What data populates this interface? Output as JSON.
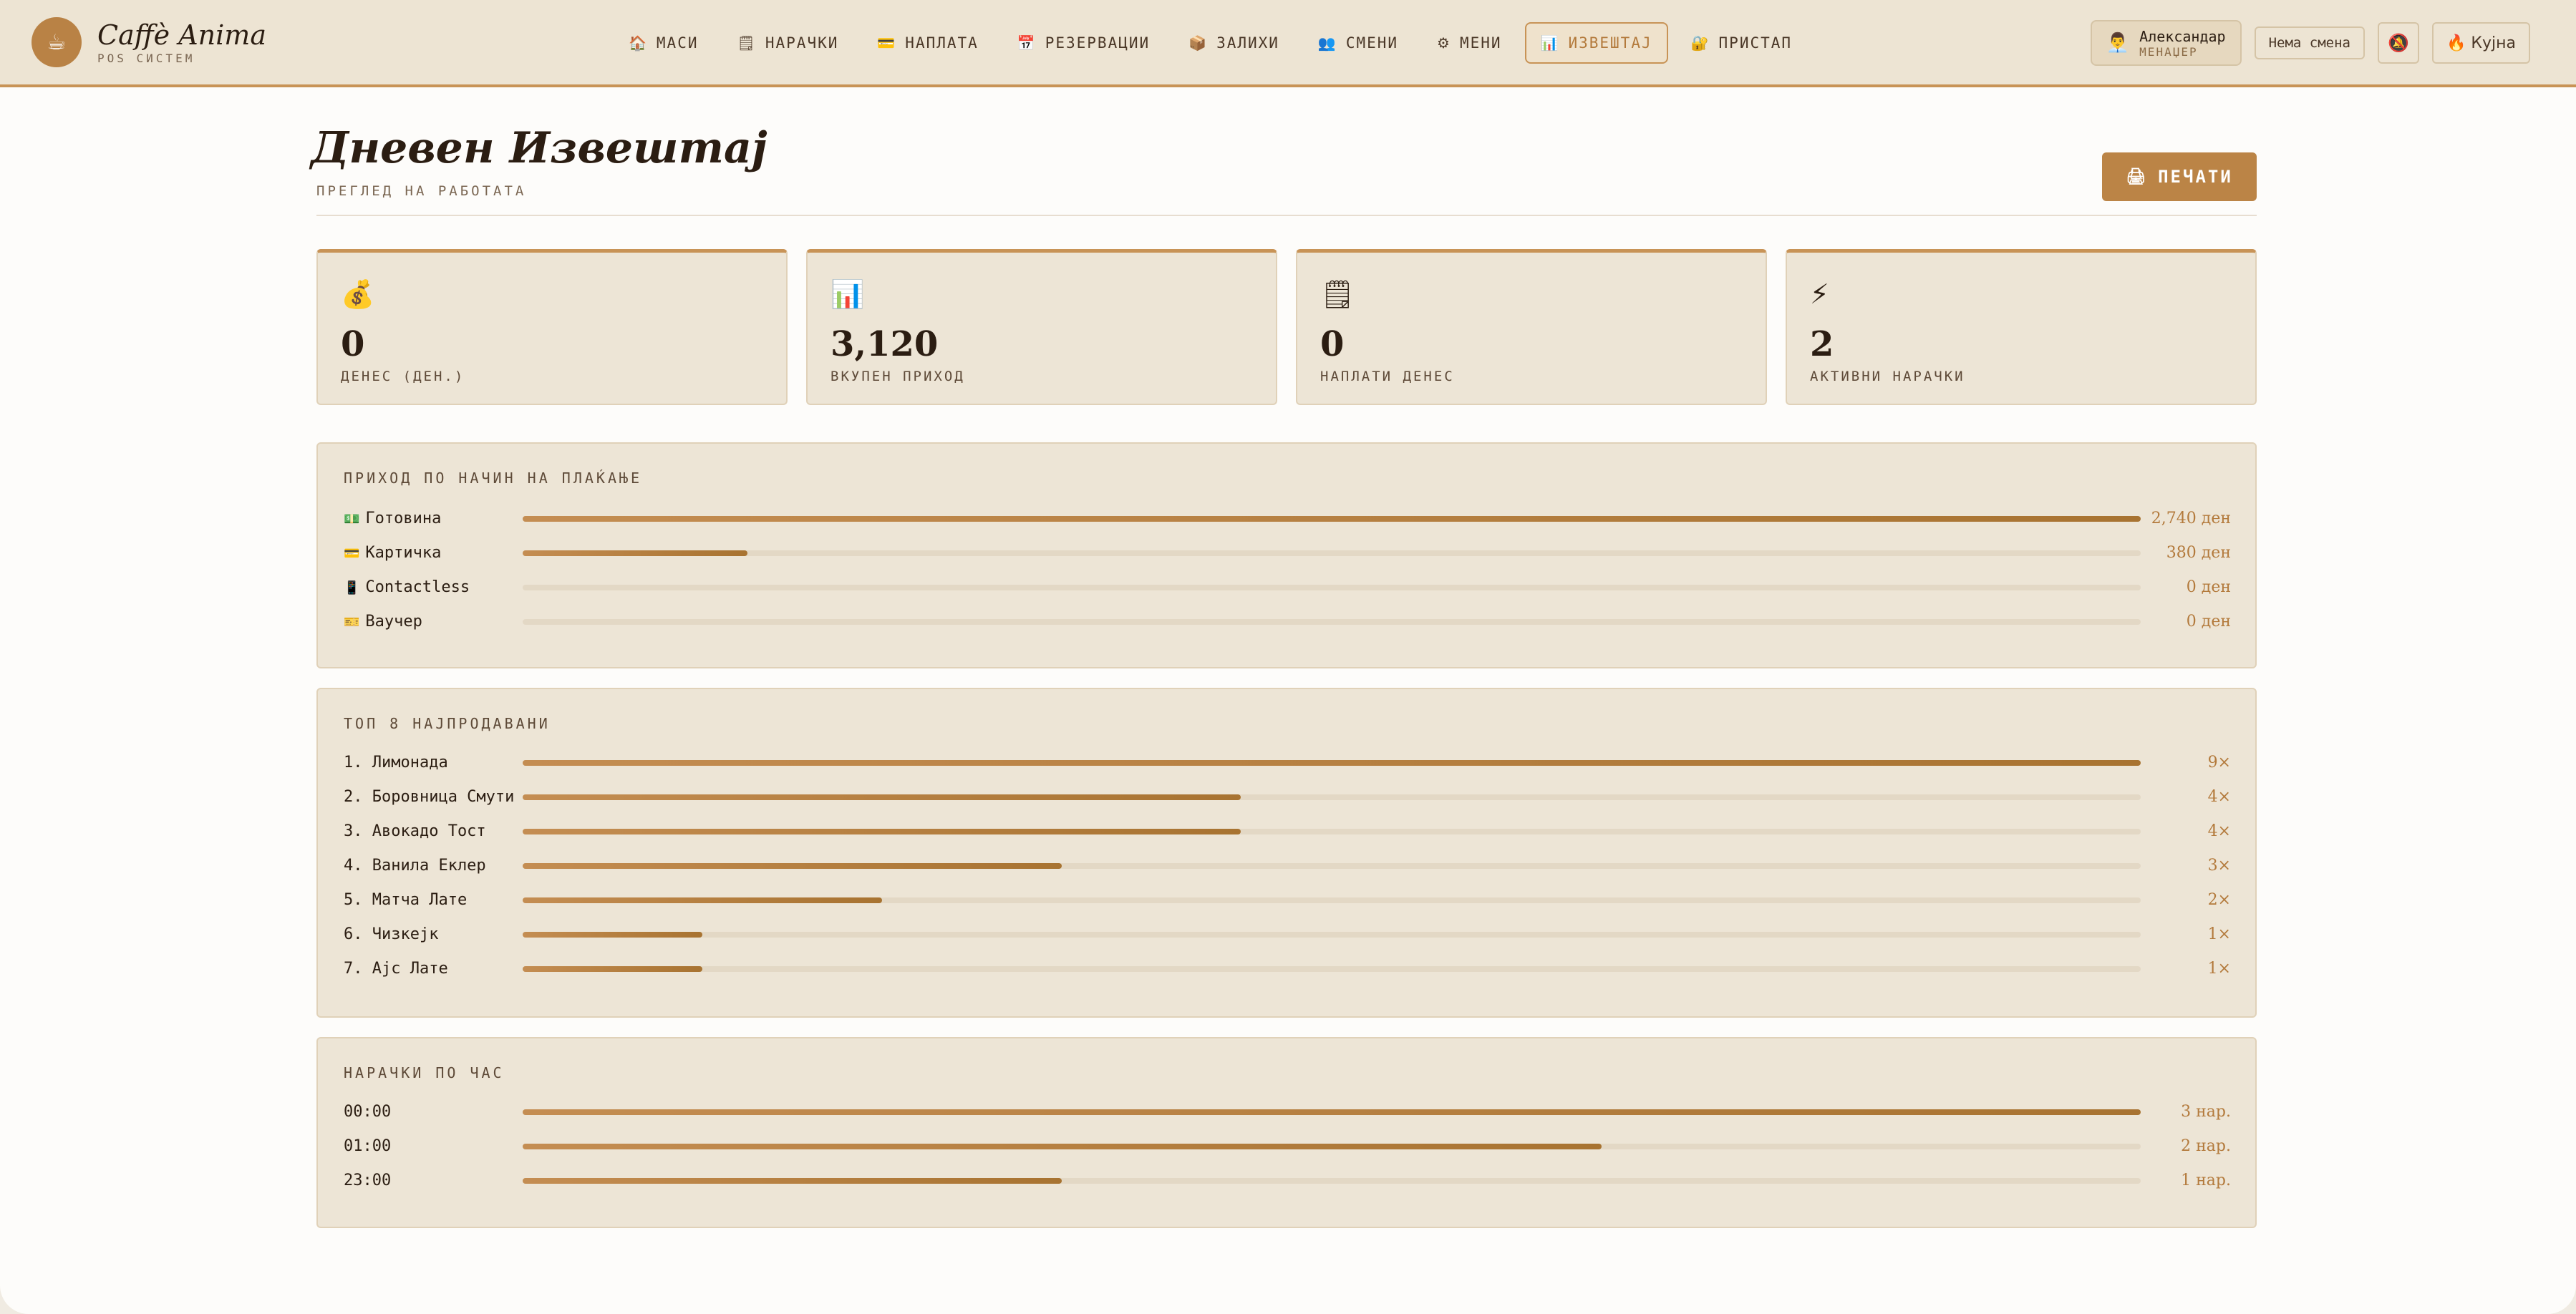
{
  "app": {
    "title": "Caffè Anima",
    "subtitle": "POS СИСТЕМ",
    "logo_icon": "coffee-cup-icon"
  },
  "nav": [
    {
      "id": "masi",
      "label": "МАСИ",
      "icon": "🏠"
    },
    {
      "id": "narachki",
      "label": "НАРАЧКИ",
      "icon": "🗒"
    },
    {
      "id": "naplata",
      "label": "НАПЛАТА",
      "icon": "💳"
    },
    {
      "id": "rezervacii",
      "label": "РЕЗЕРВАЦИИ",
      "icon": "📅"
    },
    {
      "id": "zalihi",
      "label": "ЗАЛИХИ",
      "icon": "📦"
    },
    {
      "id": "smeni",
      "label": "СМЕНИ",
      "icon": "👥"
    },
    {
      "id": "meni",
      "label": "МЕНИ",
      "icon": "⚙"
    },
    {
      "id": "izveshtaj",
      "label": "ИЗВЕШТАЈ",
      "icon": "📊",
      "active": true
    },
    {
      "id": "pristap",
      "label": "ПРИСТАП",
      "icon": "🔐"
    }
  ],
  "user": {
    "name": "Александар",
    "role": "МЕНАЏЕР",
    "icon": "👨‍💼"
  },
  "shift_status": "Нема смена",
  "bell_icon": "🔕",
  "kitchen_label": "🔥 Кујна",
  "page": {
    "title": "Дневен Извештај",
    "subtitle": "ПРЕГЛЕД НА РАБОТАТА",
    "print_icon": "🖨",
    "print_label": "ПЕЧАТИ"
  },
  "stats": [
    {
      "icon": "💰",
      "value": "0",
      "label": "ДЕНЕС (ДЕН.)"
    },
    {
      "icon": "📊",
      "value": "3,120",
      "label": "ВКУПЕН ПРИХОД"
    },
    {
      "icon": "🗒",
      "value": "0",
      "label": "НАПЛАТИ ДЕНЕС"
    },
    {
      "icon": "⚡",
      "value": "2",
      "label": "АКТИВНИ НАРАЧКИ"
    }
  ],
  "payment_panel": {
    "title": "ПРИХОД ПО НАЧИН НА ПЛАЌАЊЕ",
    "rows": [
      {
        "icon": "💵",
        "label": "Готовина",
        "value": "2,740 ден",
        "fraction": 1.0
      },
      {
        "icon": "💳",
        "label": "Картичка",
        "value": "380 ден",
        "fraction": 0.139
      },
      {
        "icon": "📱",
        "label": "Contactless",
        "value": "0 ден",
        "fraction": 0
      },
      {
        "icon": "🎫",
        "label": "Ваучер",
        "value": "0 ден",
        "fraction": 0
      }
    ]
  },
  "top_panel": {
    "title": "ТОП 8 НАЈПРОДАВАНИ",
    "rows": [
      {
        "label": "1. Лимонада",
        "value": "9×",
        "fraction": 1.0
      },
      {
        "label": "2. Боровница Смути",
        "value": "4×",
        "fraction": 0.444
      },
      {
        "label": "3. Авокадо Тост",
        "value": "4×",
        "fraction": 0.444
      },
      {
        "label": "4. Ванила Еклер",
        "value": "3×",
        "fraction": 0.333
      },
      {
        "label": "5. Матча Лате",
        "value": "2×",
        "fraction": 0.222
      },
      {
        "label": "6. Чизкејк",
        "value": "1×",
        "fraction": 0.111
      },
      {
        "label": "7. Ајс Лате",
        "value": "1×",
        "fraction": 0.111
      }
    ]
  },
  "hour_panel": {
    "title": "НАРАЧКИ ПО ЧАС",
    "rows": [
      {
        "label": "00:00",
        "value": "3 нар.",
        "fraction": 1.0
      },
      {
        "label": "01:00",
        "value": "2 нар.",
        "fraction": 0.667
      },
      {
        "label": "23:00",
        "value": "1 нар.",
        "fraction": 0.333
      }
    ]
  }
}
